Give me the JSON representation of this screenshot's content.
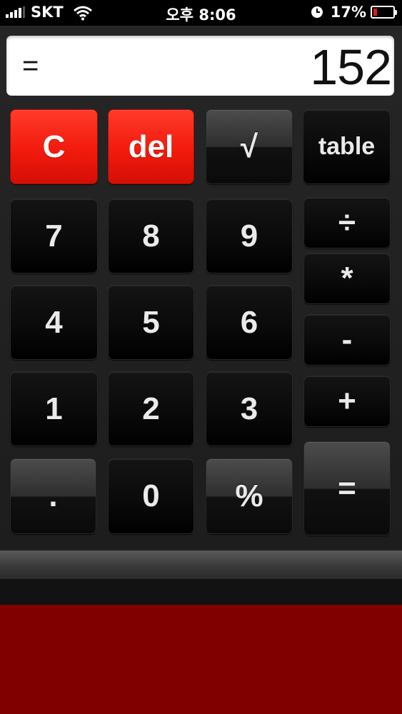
{
  "status_bar": {
    "carrier": "SKT",
    "time": "오후 8:06",
    "battery_percent": "17%",
    "battery_level": 0.17,
    "icons": [
      "signal-icon",
      "wifi-icon",
      "clock-icon",
      "battery-icon"
    ]
  },
  "display": {
    "operator": "=",
    "value": "152"
  },
  "keys": {
    "clear": "C",
    "delete": "del",
    "sqrt": "√",
    "table": "table",
    "seven": "7",
    "eight": "8",
    "nine": "9",
    "divide": "÷",
    "multiply": "*",
    "four": "4",
    "five": "5",
    "six": "6",
    "minus": "-",
    "one": "1",
    "two": "2",
    "three": "3",
    "plus": "+",
    "point": ".",
    "zero": "0",
    "percent": "%",
    "equals": "="
  },
  "colors": {
    "accent_red": "#f21a0c",
    "ad_area": "#800000",
    "display_bg": "#ffffff"
  }
}
